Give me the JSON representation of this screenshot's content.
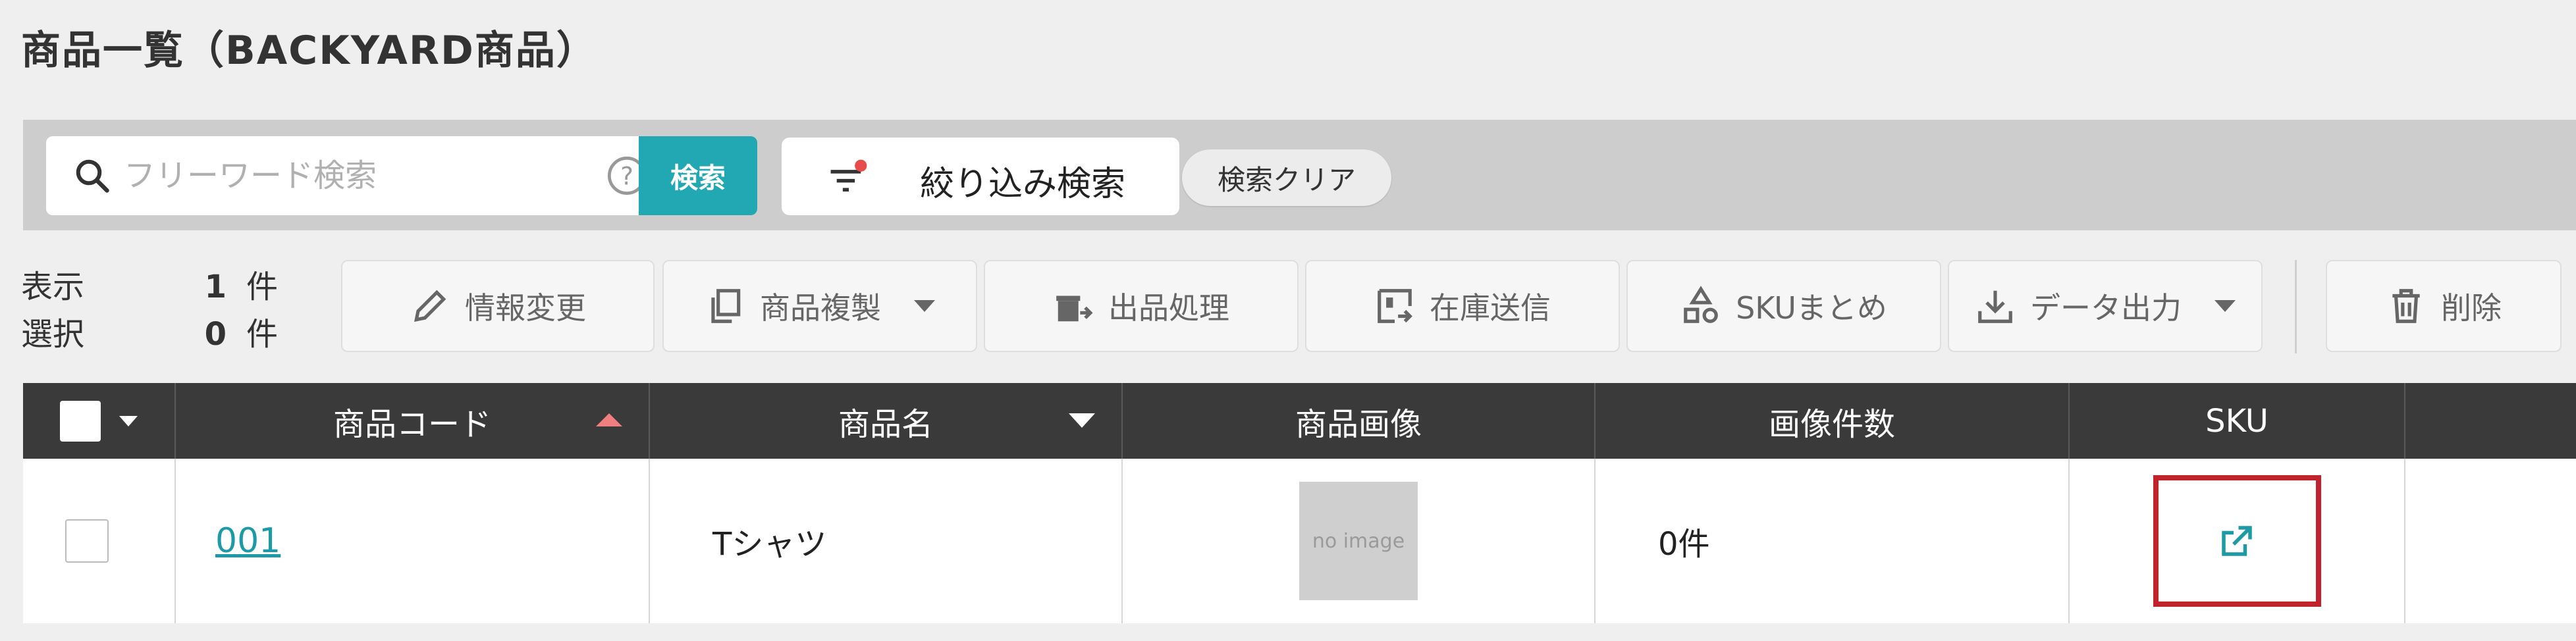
{
  "page": {
    "title": "商品一覧（BACKYARD商品）"
  },
  "search": {
    "placeholder": "フリーワード検索",
    "button_label": "検索",
    "filter_label": "絞り込み検索",
    "clear_label": "検索クリア"
  },
  "counts": {
    "display_label": "表示",
    "display_value": "1",
    "select_label": "選択",
    "select_value": "0",
    "unit": "件"
  },
  "toolbar": {
    "edit": "情報変更",
    "duplicate": "商品複製",
    "listing": "出品処理",
    "stock_send": "在庫送信",
    "sku_group": "SKUまとめ",
    "data_export": "データ出力",
    "delete": "削除"
  },
  "table": {
    "headers": {
      "code": "商品コード",
      "name": "商品名",
      "image": "商品画像",
      "image_count": "画像件数",
      "sku": "SKU"
    },
    "rows": [
      {
        "code": "001",
        "name": "Tシャツ",
        "image_placeholder": "no image",
        "image_count": "0件"
      }
    ]
  },
  "colors": {
    "accent": "#22a8b2",
    "header_bg": "#3a3a3a",
    "highlight": "#c0232c",
    "filter_dot": "#e84b4b",
    "sort_asc": "#f08080"
  }
}
